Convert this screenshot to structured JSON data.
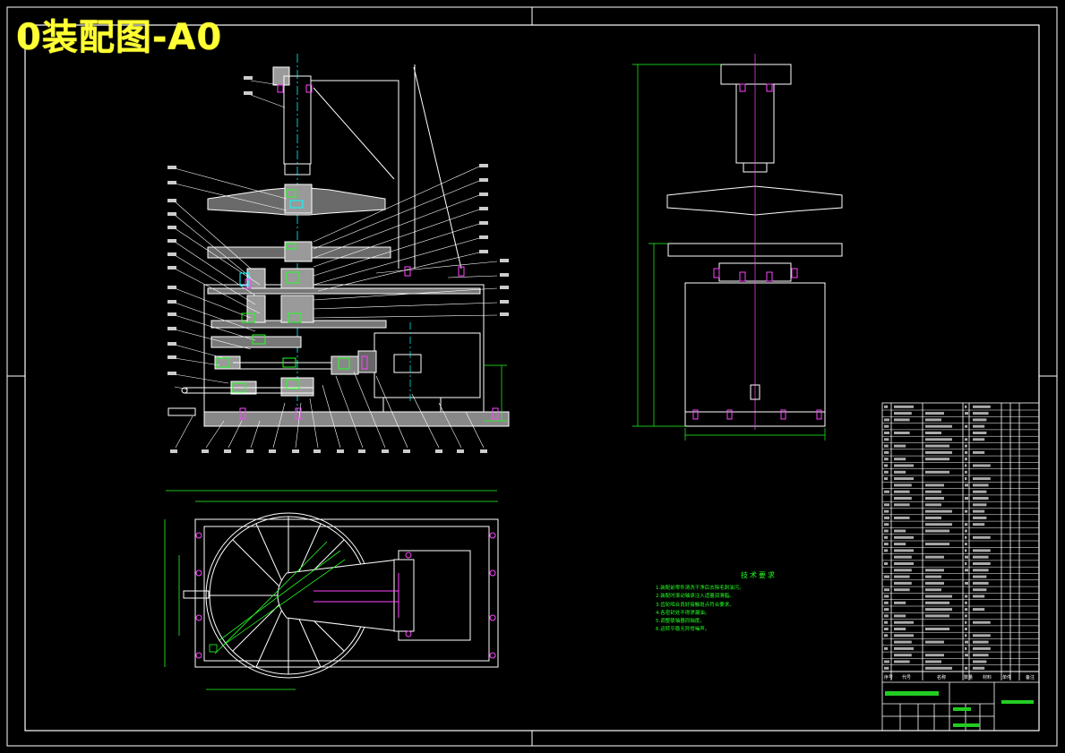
{
  "drawing": {
    "title": "0装配图-A0",
    "colors": {
      "background": "#000000",
      "outline": "#ffffff",
      "dimension": "#22ff22",
      "section": "#00ffff",
      "fastener": "#ff44ff",
      "title": "#ffff33"
    }
  },
  "technical_notes": {
    "heading": "技术要求",
    "lines": [
      "1.装配前零件清洗干净后去除毛刺油污。",
      "2.装配时滚动轴承注入适量润滑脂。",
      "3.齿轮啮合良好接触斑点符合要求。",
      "4.各密封处不得渗漏油。",
      "5.调整联轴器同轴度。",
      "6.运转平稳无异常噪声。"
    ]
  },
  "title_block": {
    "columns": [
      "序号",
      "代号",
      "名称",
      "数量",
      "材料",
      "单件",
      "备注"
    ]
  }
}
